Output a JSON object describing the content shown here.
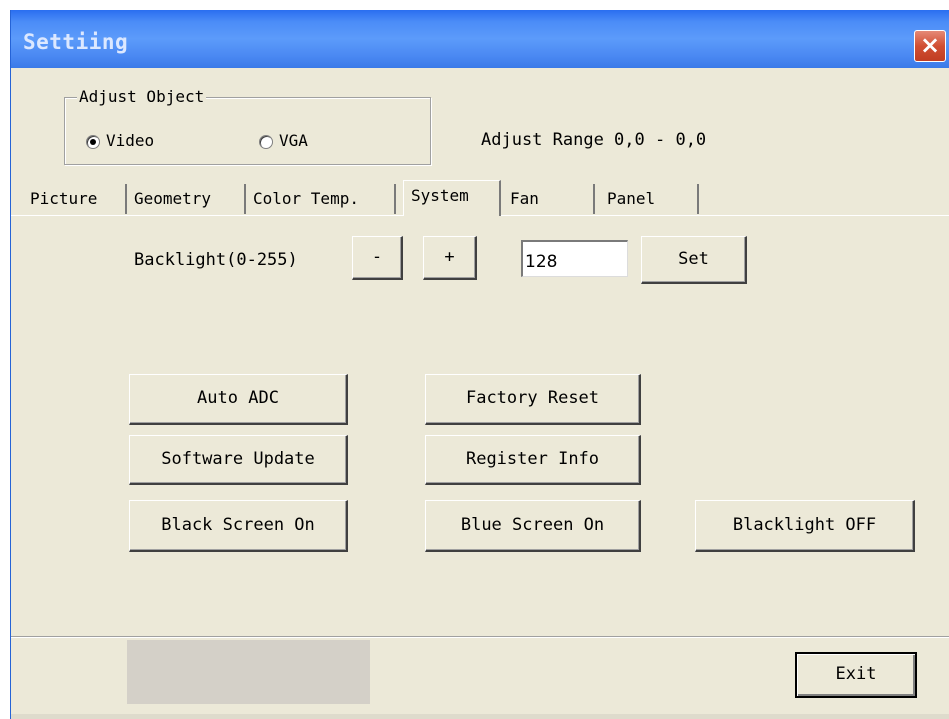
{
  "window": {
    "title": "Settiing",
    "close_glyph": "×"
  },
  "adjust_object": {
    "legend": "Adjust Object",
    "options": [
      {
        "label": "Video",
        "selected": true
      },
      {
        "label": "VGA",
        "selected": false
      }
    ]
  },
  "adjust_range": "Adjust Range 0,0 - 0,0",
  "tabs": [
    {
      "label": "Picture",
      "active": false
    },
    {
      "label": "Geometry",
      "active": false
    },
    {
      "label": "Color Temp.",
      "active": false
    },
    {
      "label": "System",
      "active": true
    },
    {
      "label": "Fan",
      "active": false
    },
    {
      "label": "Panel",
      "active": false
    }
  ],
  "backlight": {
    "label": "Backlight(0-255)",
    "minus_label": "-",
    "plus_label": "+",
    "value": "128",
    "set_label": "Set"
  },
  "actions": {
    "auto_adc": "Auto ADC",
    "factory_reset": "Factory Reset",
    "software_update": "Software Update",
    "register_info": "Register Info",
    "black_screen_on": "Black Screen On",
    "blue_screen_on": "Blue Screen On",
    "blacklight_off": "Blacklight OFF"
  },
  "footer": {
    "exit_label": "Exit"
  },
  "colors": {
    "title_bar": "#4b8cf7",
    "dialog_face": "#ece9d8",
    "close_button": "#d14f33"
  }
}
